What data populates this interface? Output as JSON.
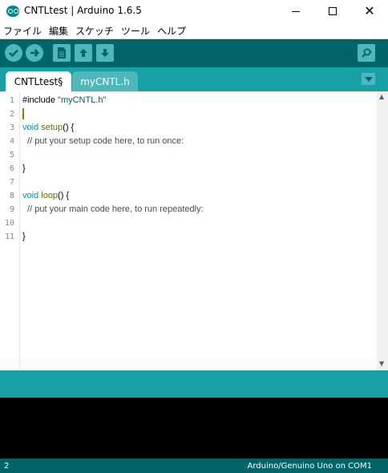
{
  "window": {
    "title": "CNTLtest | Arduino 1.6.5",
    "close_glyph": "✕"
  },
  "menu": [
    "ファイル",
    "編集",
    "スケッチ",
    "ツール",
    "ヘルプ"
  ],
  "toolbar": {
    "buttons": [
      {
        "name": "verify",
        "icon": "check-icon"
      },
      {
        "name": "upload",
        "icon": "arrow-right-icon"
      },
      {
        "name": "new",
        "icon": "file-icon"
      },
      {
        "name": "open",
        "icon": "arrow-up-icon"
      },
      {
        "name": "save",
        "icon": "arrow-down-icon"
      },
      {
        "name": "serial-monitor",
        "icon": "magnifier-icon"
      }
    ]
  },
  "tabs": [
    {
      "label": "CNTLtest§",
      "active": true
    },
    {
      "label": "myCNTL.h",
      "active": false
    }
  ],
  "editor": {
    "line_numbers": [
      "1",
      "2",
      "3",
      "4",
      "5",
      "6",
      "7",
      "8",
      "9",
      "10",
      "11"
    ],
    "lines": [
      "#include \"myCNTL.h\"",
      "",
      "void setup() {",
      "  // put your setup code here, to run once:",
      "",
      "}",
      "",
      "void loop() {",
      "  // put your main code here, to run repeatedly:",
      "",
      "}"
    ],
    "caret_line": 2
  },
  "status": {
    "line": "2",
    "board": "Arduino/Genuino Uno on COM1"
  },
  "colors": {
    "toolbar": "#006468",
    "tabs_bar": "#17a1a5",
    "button": "#4db7bb",
    "keyword": "#00979d",
    "function": "#5e6d03"
  }
}
